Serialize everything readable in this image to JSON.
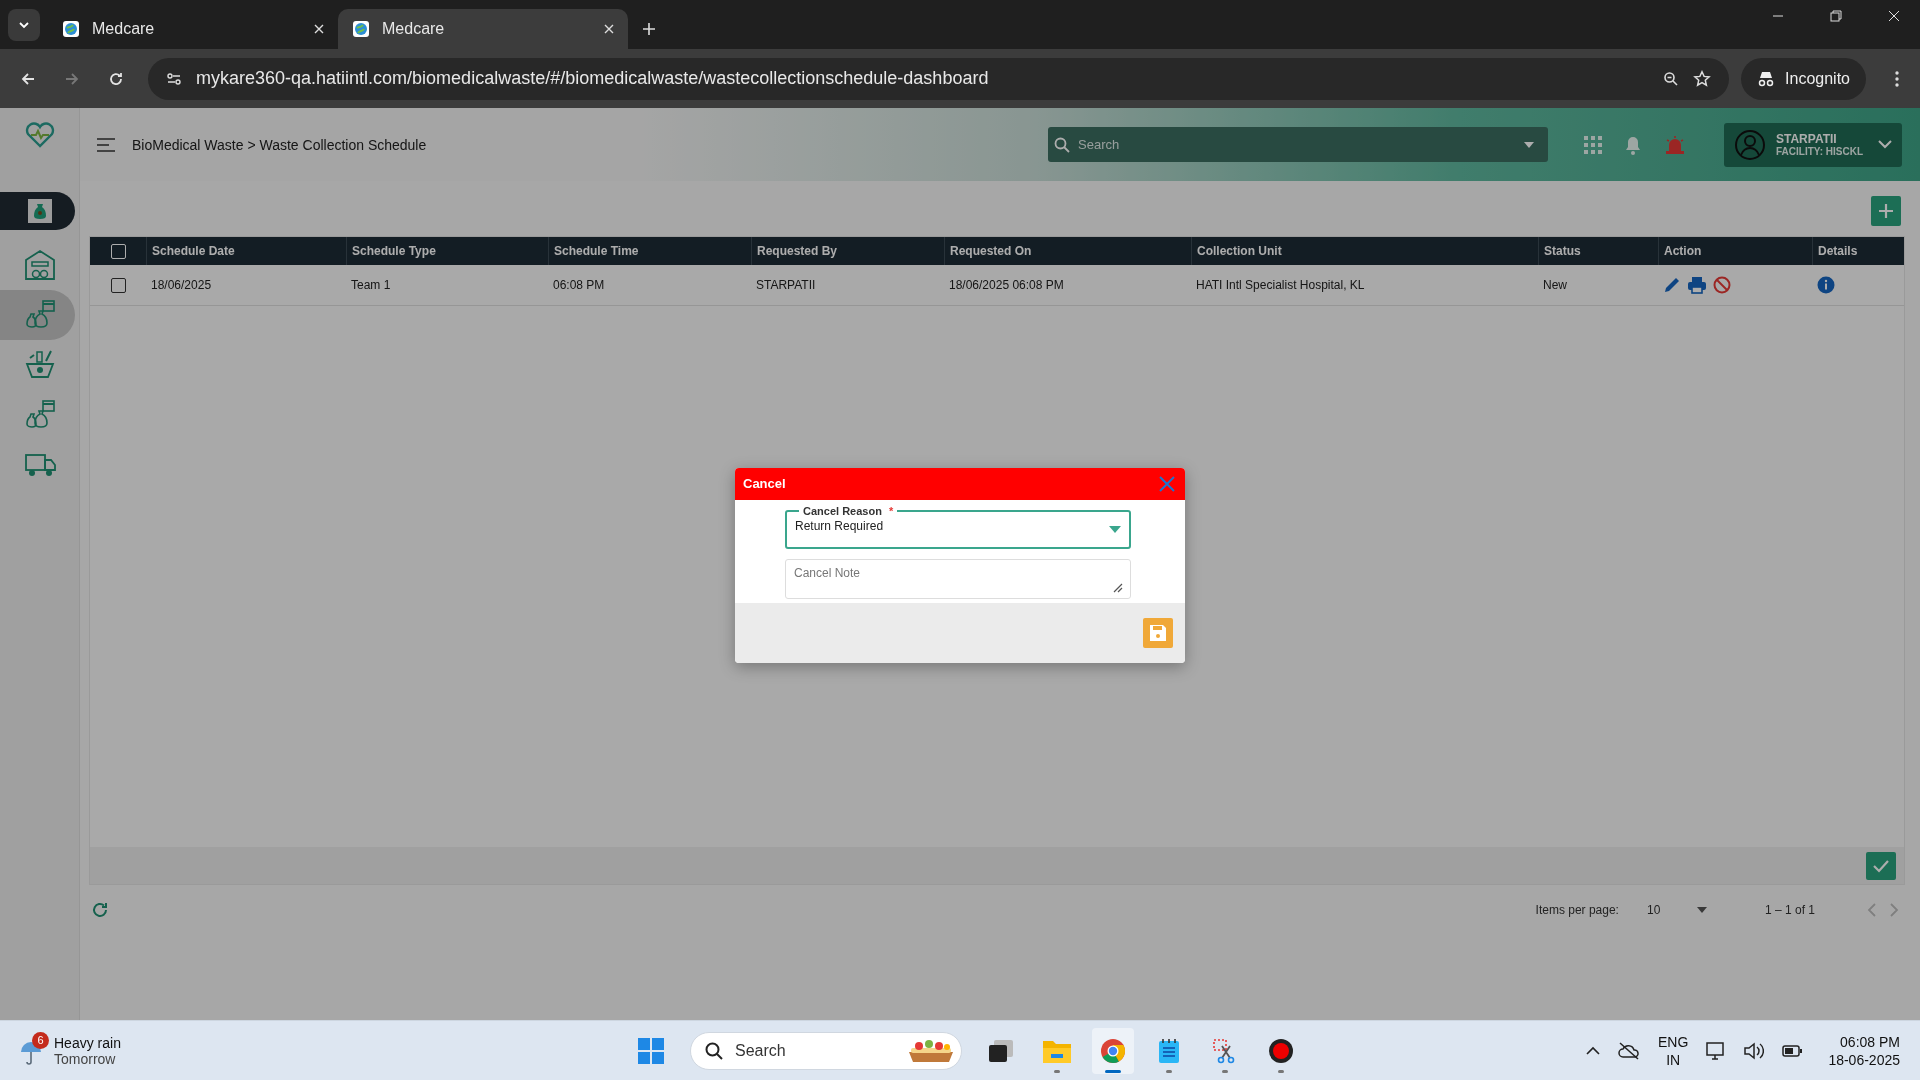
{
  "browser": {
    "tabs": [
      {
        "title": "Medcare",
        "selected": false
      },
      {
        "title": "Medcare",
        "selected": true
      }
    ],
    "url": "mykare360-qa.hatiintl.com/biomedicalwaste/#/biomedicalwaste/wastecollectionschedule-dashboard",
    "profile": "Incognito"
  },
  "sidebar": {
    "items": [
      {
        "kind": "bag",
        "selected": true,
        "hovered": false
      },
      {
        "kind": "warehouse",
        "selected": false,
        "hovered": false
      },
      {
        "kind": "bags-calendar",
        "selected": false,
        "hovered": true
      },
      {
        "kind": "basket",
        "selected": false,
        "hovered": false
      },
      {
        "kind": "bags-calendar",
        "selected": false,
        "hovered": false
      },
      {
        "kind": "truck",
        "selected": false,
        "hovered": false
      }
    ]
  },
  "header": {
    "breadcrumb": "BioMedical Waste > Waste Collection Schedule",
    "search": {
      "placeholder": "Search"
    },
    "user": {
      "name": "STARPATII",
      "facility": "FACILITY: HISCKL"
    }
  },
  "table": {
    "all_checked": false,
    "columns": [
      "Schedule Date",
      "Schedule Type",
      "Schedule Time",
      "Requested By",
      "Requested On",
      "Collection Unit",
      "Status",
      "Action",
      "Details"
    ],
    "rows": [
      {
        "checked": false,
        "cells": [
          "18/06/2025",
          "Team 1",
          "06:08 PM",
          "STARPATII",
          "18/06/2025 06:08 PM",
          "HATI Intl Specialist Hospital, KL",
          "New"
        ]
      }
    ]
  },
  "pagination": {
    "label": "Items per page:",
    "page_size": "10",
    "range": "1 – 1 of 1"
  },
  "dialog": {
    "title": "Cancel",
    "reason": {
      "label": "Cancel Reason",
      "required_mark": "*",
      "value": "Return Required"
    },
    "note": {
      "placeholder": "Cancel Note"
    }
  },
  "taskbar": {
    "weather": {
      "badge": "6",
      "title": "Heavy rain",
      "subtitle": "Tomorrow"
    },
    "search": {
      "placeholder": "Search"
    },
    "apps": [
      {
        "kind": "start",
        "running": false,
        "active": false
      },
      {
        "kind": "task-view",
        "running": false,
        "active": false
      },
      {
        "kind": "folder",
        "running": true,
        "active": false
      },
      {
        "kind": "browser",
        "running": true,
        "active": true
      },
      {
        "kind": "notepad",
        "running": true,
        "active": false
      },
      {
        "kind": "snip",
        "running": true,
        "active": false
      },
      {
        "kind": "record",
        "running": true,
        "active": false
      }
    ],
    "tray": {
      "language": "ENG",
      "region": "IN",
      "time": "06:08 PM",
      "date": "18-06-2025"
    }
  }
}
